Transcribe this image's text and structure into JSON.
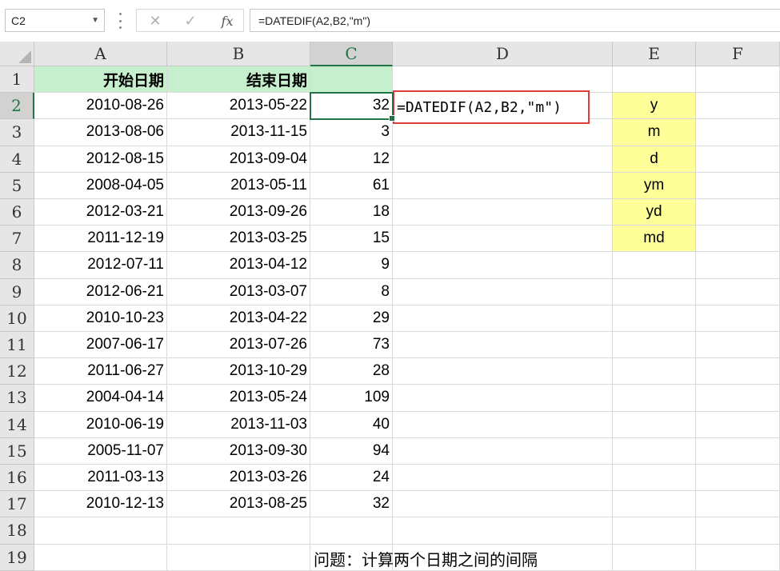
{
  "namebox": {
    "value": "C2"
  },
  "formula_bar": {
    "value": "=DATEDIF(A2,B2,\"m\")"
  },
  "buttons": {
    "cancel": "✕",
    "enter": "✓",
    "fx": "fx"
  },
  "columns": [
    "A",
    "B",
    "C",
    "D",
    "E",
    "F"
  ],
  "rows": [
    "1",
    "2",
    "3",
    "4",
    "5",
    "6",
    "7",
    "8",
    "9",
    "10",
    "11",
    "12",
    "13",
    "14",
    "15",
    "16",
    "17",
    "18",
    "19"
  ],
  "header": {
    "start": "开始日期",
    "end": "结束日期"
  },
  "data": [
    {
      "start": "2010-08-26",
      "end": "2013-05-22",
      "diff": "32"
    },
    {
      "start": "2013-08-06",
      "end": "2013-11-15",
      "diff": "3"
    },
    {
      "start": "2012-08-15",
      "end": "2013-09-04",
      "diff": "12"
    },
    {
      "start": "2008-04-05",
      "end": "2013-05-11",
      "diff": "61"
    },
    {
      "start": "2012-03-21",
      "end": "2013-09-26",
      "diff": "18"
    },
    {
      "start": "2011-12-19",
      "end": "2013-03-25",
      "diff": "15"
    },
    {
      "start": "2012-07-11",
      "end": "2013-04-12",
      "diff": "9"
    },
    {
      "start": "2012-06-21",
      "end": "2013-03-07",
      "diff": "8"
    },
    {
      "start": "2010-10-23",
      "end": "2013-04-22",
      "diff": "29"
    },
    {
      "start": "2007-06-17",
      "end": "2013-07-26",
      "diff": "73"
    },
    {
      "start": "2011-06-27",
      "end": "2013-10-29",
      "diff": "28"
    },
    {
      "start": "2004-04-14",
      "end": "2013-05-24",
      "diff": "109"
    },
    {
      "start": "2010-06-19",
      "end": "2013-11-03",
      "diff": "40"
    },
    {
      "start": "2005-11-07",
      "end": "2013-09-30",
      "diff": "94"
    },
    {
      "start": "2011-03-13",
      "end": "2013-03-26",
      "diff": "24"
    },
    {
      "start": "2010-12-13",
      "end": "2013-08-25",
      "diff": "32"
    }
  ],
  "units": [
    "y",
    "m",
    "d",
    "ym",
    "yd",
    "md"
  ],
  "formula_note": "=DATEDIF(A2,B2,\"m\")",
  "question": "问题：计算两个日期之间的间隔",
  "colors": {
    "header_fill": "#c6efce",
    "unit_fill": "#ffff99",
    "accent": "#217346",
    "note_border": "#e03c3c"
  }
}
